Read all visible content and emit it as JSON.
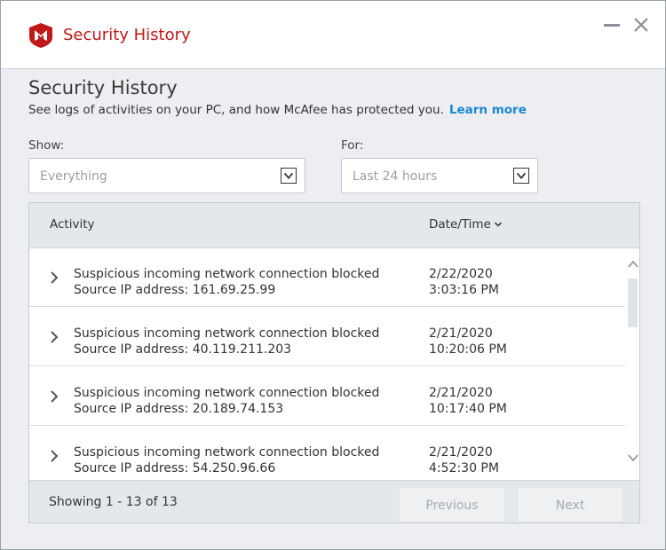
{
  "window": {
    "title": "Security History",
    "brand_color": "#c01818"
  },
  "header": {
    "title": "Security History",
    "subtitle": "See logs of activities on your PC, and how McAfee has protected you.",
    "learn_more": "Learn more",
    "link_color": "#1a87d1"
  },
  "filters": {
    "show_label": "Show:",
    "show_value": "Everything",
    "for_label": "For:",
    "for_value": "Last 24 hours"
  },
  "table": {
    "columns": [
      "Activity",
      "Date/Time"
    ],
    "rows": [
      {
        "activity": "Suspicious incoming network connection blocked",
        "detail": "Source IP address: 161.69.25.99",
        "date": "2/22/2020",
        "time": "3:03:16 PM"
      },
      {
        "activity": "Suspicious incoming network connection blocked",
        "detail": "Source IP address: 40.119.211.203",
        "date": "2/21/2020",
        "time": "10:20:06 PM"
      },
      {
        "activity": "Suspicious incoming network connection blocked",
        "detail": "Source IP address: 20.189.74.153",
        "date": "2/21/2020",
        "time": "10:17:40 PM"
      },
      {
        "activity": "Suspicious incoming network connection blocked",
        "detail": "Source IP address: 54.250.96.66",
        "date": "2/21/2020",
        "time": "4:52:30 PM"
      }
    ]
  },
  "pagination": {
    "showing": "Showing 1 - 13 of 13",
    "previous": "Previous",
    "next": "Next"
  },
  "icons": {
    "logo": "mcafee-shield-icon",
    "minimize": "minimize-icon",
    "close": "close-icon",
    "sort": "chevron-down-icon",
    "expand": "chevron-right-icon"
  }
}
